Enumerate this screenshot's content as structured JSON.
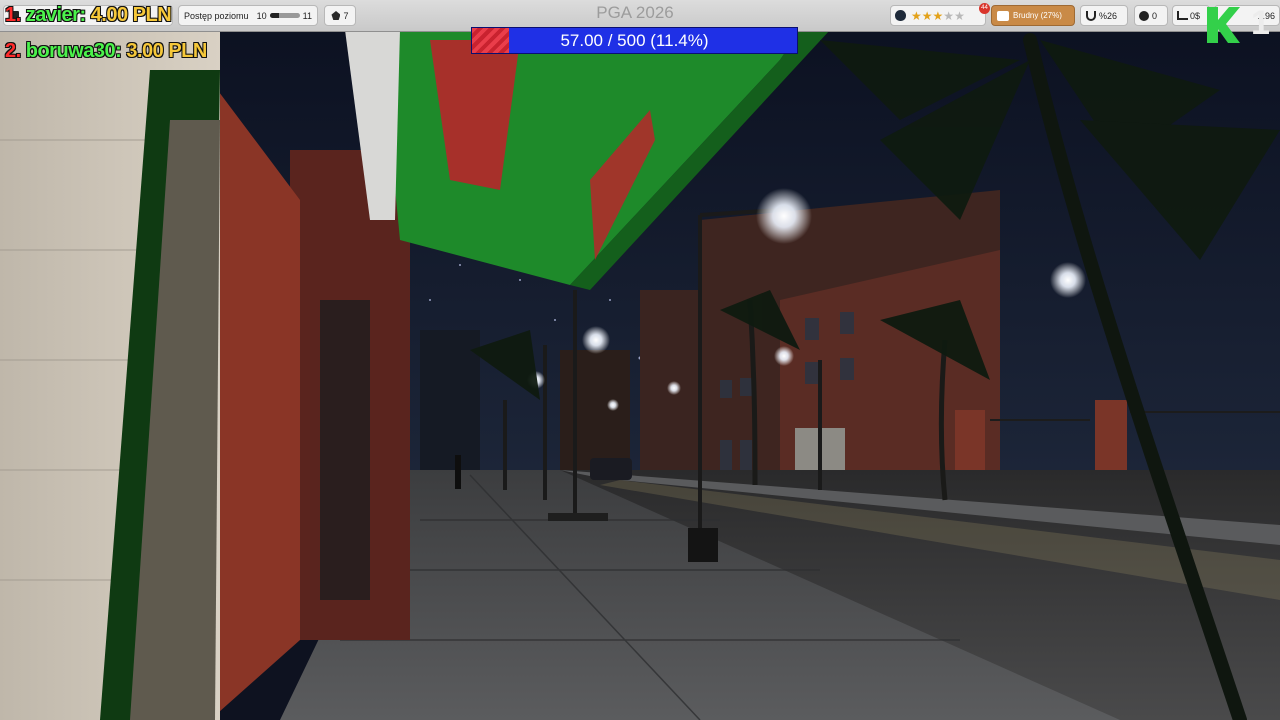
{
  "hud": {
    "level": {
      "label": "Postęp poziomu",
      "current": "10",
      "next": "11",
      "progress": 0.3
    },
    "boxes": {
      "icon": "box-icon",
      "count": "7"
    },
    "store_title": "PGA 2026",
    "rating": {
      "stars_filled": 3,
      "stars_total": 5,
      "notification_count": "44"
    },
    "cleanliness": {
      "label": "Brudny (27%)",
      "icon": "broom-icon",
      "color": "#c98a47"
    },
    "security": {
      "label": "%26",
      "icon": "magnet-icon"
    },
    "customers": {
      "label": "0",
      "icon": "customer-icon"
    },
    "stats": {
      "label": "0$",
      "icon": "chart-icon"
    },
    "money": {
      "label": "1.96"
    }
  },
  "goal": {
    "label": "57.00 / 500 (11.4%)",
    "current": 57.0,
    "target": 500,
    "fill_color": "#ea3d4a",
    "track_color": "#1f30e6"
  },
  "leaderboard": [
    {
      "rank": "1.",
      "name": "zavier:",
      "amount": "4.00 PLN"
    },
    {
      "rank": "2.",
      "name": "boruwa30:",
      "amount": "3.00 PLN"
    }
  ],
  "logo": {
    "number": "1",
    "color": "#33d04a"
  }
}
